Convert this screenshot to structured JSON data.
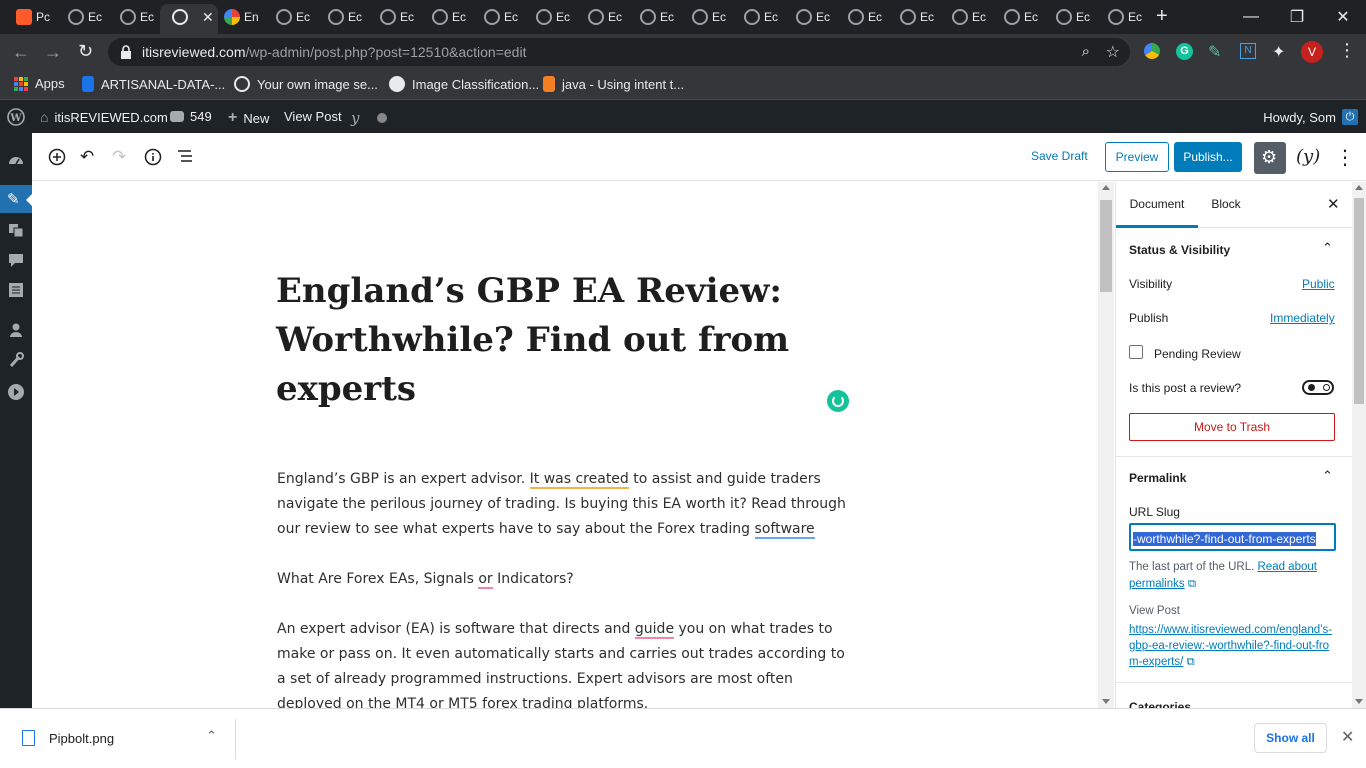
{
  "browser": {
    "tabs": [
      {
        "label": "Pc"
      },
      {
        "label": "Ec"
      },
      {
        "label": "Ec"
      },
      {
        "label": ""
      },
      {
        "label": "En"
      },
      {
        "label": "Ec"
      },
      {
        "label": "Ec"
      },
      {
        "label": "Ec"
      },
      {
        "label": "Ec"
      },
      {
        "label": "Ec"
      },
      {
        "label": "Ec"
      },
      {
        "label": "Ec"
      },
      {
        "label": "Ec"
      },
      {
        "label": "Ec"
      },
      {
        "label": "Ec"
      },
      {
        "label": "Ec"
      },
      {
        "label": "Ec"
      },
      {
        "label": "Ec"
      },
      {
        "label": "Ec"
      },
      {
        "label": "Ec"
      },
      {
        "label": "Ec"
      },
      {
        "label": "Ec"
      }
    ],
    "url_host": "itisreviewed.com",
    "url_path": "/wp-admin/post.php?post=12510&action=edit",
    "profile_initial": "V",
    "bookmarks": [
      {
        "label": "Apps"
      },
      {
        "label": "ARTISANAL-DATA-..."
      },
      {
        "label": "Your own image se..."
      },
      {
        "label": "Image Classification..."
      },
      {
        "label": "java - Using intent t..."
      }
    ]
  },
  "adminbar": {
    "site": "itisREVIEWED.com",
    "comments": "549",
    "new": "New",
    "view_post": "View Post",
    "howdy": "Howdy, Som"
  },
  "toolbar": {
    "save_draft": "Save Draft",
    "preview": "Preview",
    "publish": "Publish..."
  },
  "post": {
    "title": "England’s GBP EA Review: Worthwhile? Find out from experts",
    "p1_a": "England’s GBP is an expert advisor.  ",
    "p1_link": "It was created",
    "p1_b": " to assist and guide traders navigate the perilous journey of trading. Is buying this EA worth it? Read through our review to see what experts have to say about the Forex trading ",
    "p1_c": "software",
    "p2_a": "What Are Forex EAs, Signals ",
    "p2_or": "or",
    "p2_b": " Indicators?",
    "p3_a": "An expert advisor (EA) is software that directs and ",
    "p3_guide": "guide",
    "p3_b": " you on what trades to make or pass on. It even automatically starts and carries out trades according to a set of already programmed instructions. Expert advisors are most often deployed on the MT4 or MT5 forex trading platforms."
  },
  "sidebar": {
    "tab_document": "Document",
    "tab_block": "Block",
    "status_title": "Status & Visibility",
    "visibility_label": "Visibility",
    "visibility_value": "Public",
    "publish_label": "Publish",
    "publish_value": "Immediately",
    "pending_review": "Pending Review",
    "is_review": "Is this post a review?",
    "move_trash": "Move to Trash",
    "permalink_title": "Permalink",
    "url_slug_label": "URL Slug",
    "url_slug_value": "-worthwhile?-find-out-from-experts",
    "help_text": "The last part of the URL.",
    "help_link": "Read about permalinks",
    "view_post_label": "View Post",
    "view_post_url": "https://www.itisreviewed.com/england’s-gbp-ea-review:-worthwhile?-find-out-from-experts/",
    "categories": "Categories"
  },
  "downloads": {
    "file": "Pipbolt.png",
    "show_all": "Show all"
  },
  "colors": {
    "wp_blue": "#007cba",
    "admin_dark": "#1d2327",
    "chrome_dark": "#202124",
    "trash_red": "#cc1818"
  }
}
